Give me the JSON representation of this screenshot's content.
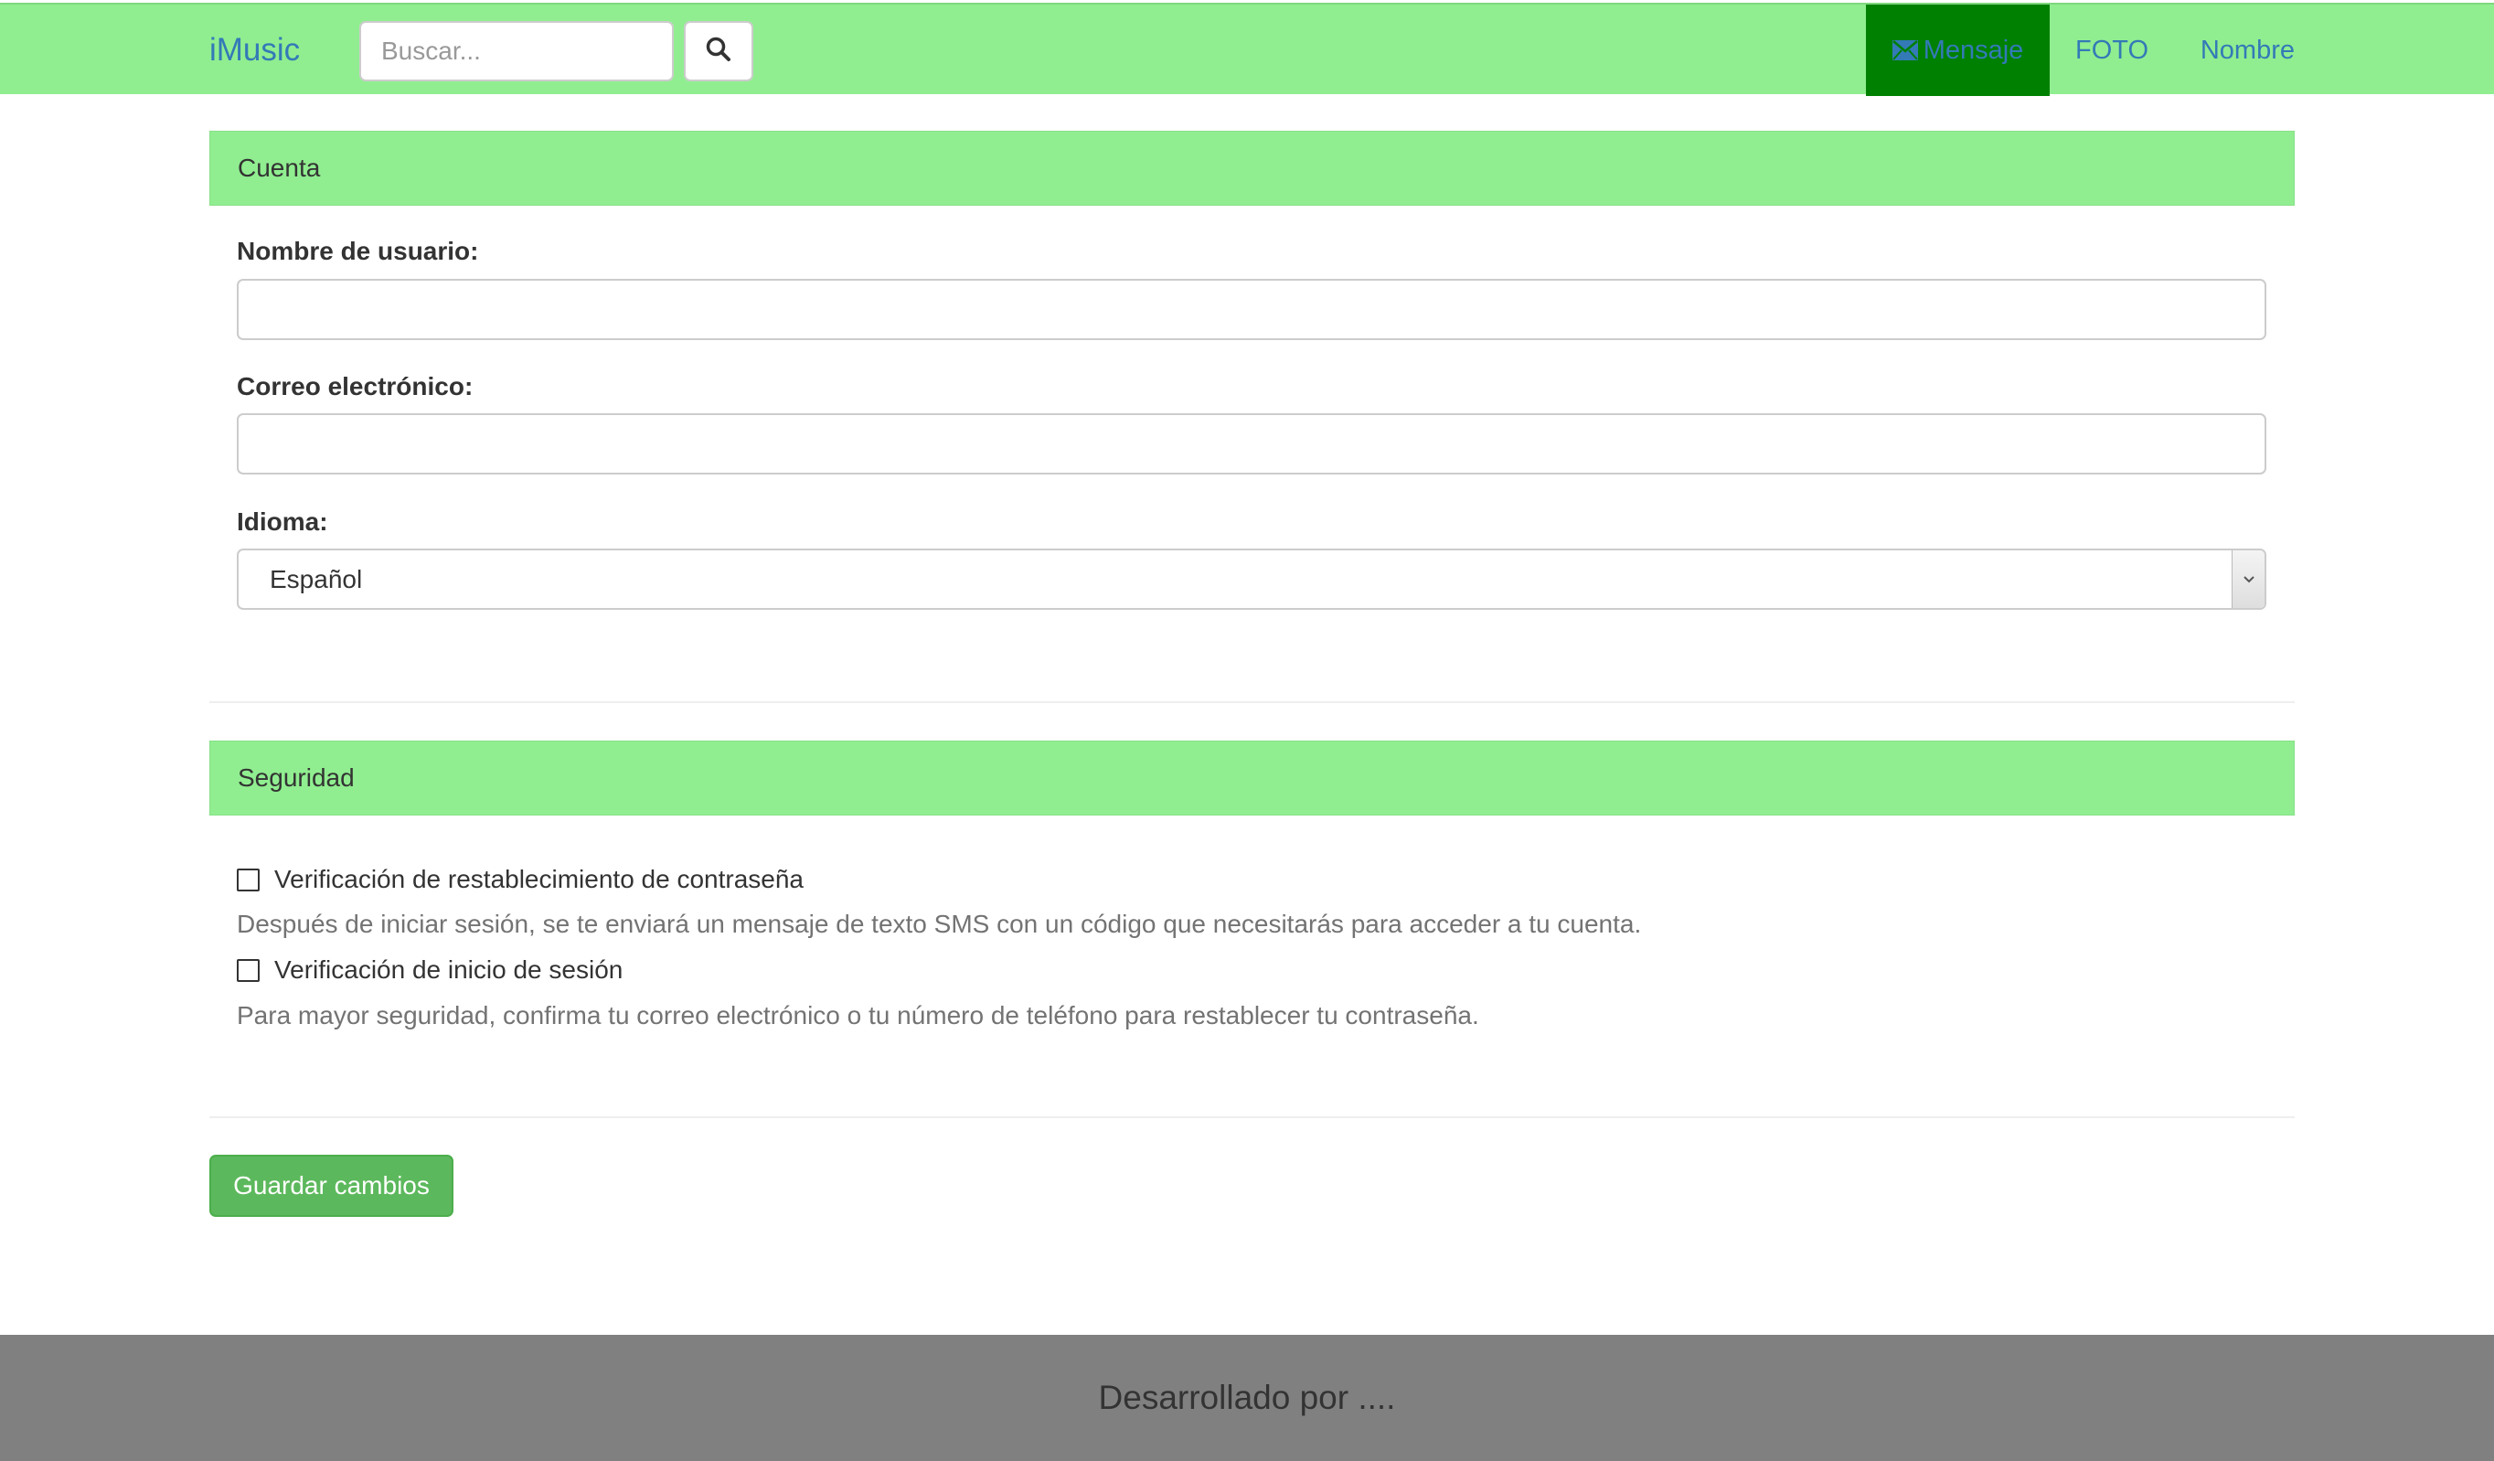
{
  "navbar": {
    "brand": "iMusic",
    "search_placeholder": "Buscar...",
    "items": [
      {
        "label": "Mensaje",
        "icon": "envelope-icon",
        "active": true
      },
      {
        "label": "FOTO"
      },
      {
        "label": "Nombre"
      }
    ]
  },
  "account": {
    "heading": "Cuenta",
    "username_label": "Nombre de usuario:",
    "username_value": "",
    "email_label": "Correo electrónico:",
    "email_value": "",
    "language_label": "Idioma:",
    "language_selected": "Español"
  },
  "security": {
    "heading": "Seguridad",
    "options": [
      {
        "label": "Verificación de restablecimiento de contraseña",
        "checked": false,
        "help": "Después de iniciar sesión, se te enviará un mensaje de texto SMS con un código que necesitarás para acceder a tu cuenta."
      },
      {
        "label": "Verificación de inicio de sesión",
        "checked": false,
        "help": "Para mayor seguridad, confirma tu correo electrónico o tu número de teléfono para restablecer tu contraseña."
      }
    ]
  },
  "save_label": "Guardar cambios",
  "footer_text": "Desarrollado por ....",
  "colors": {
    "navbar_bg": "#90ee90",
    "nav_active_bg": "#008000",
    "link": "#337ab7",
    "save_button": "#5cb85c",
    "footer_bg": "#808080"
  }
}
